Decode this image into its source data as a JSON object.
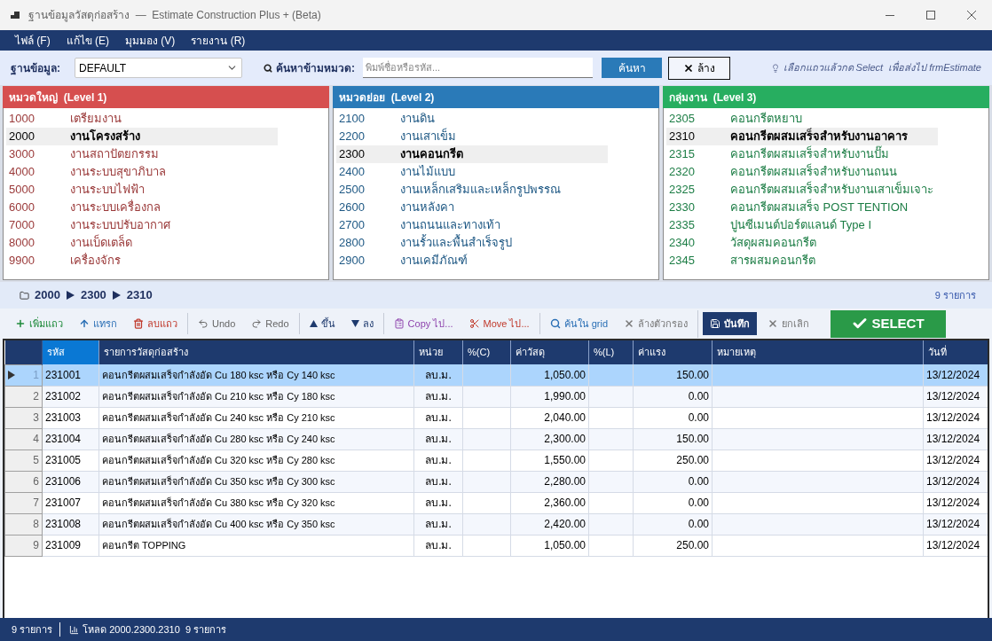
{
  "window": {
    "title": "ฐานข้อมูลวัสดุก่อสร้าง  —  Estimate Construction Plus + (Beta)"
  },
  "menu": [
    {
      "label": "ไฟล์ (F)"
    },
    {
      "label": "แก้ไข (E)"
    },
    {
      "label": "มุมมอง (V)"
    },
    {
      "label": "รายงาน (R)"
    }
  ],
  "search_bar": {
    "database_label": "ฐานข้อมูล:",
    "database": {
      "value": "DEFAULT"
    },
    "search_label": "ค้นหาข้ามหมวด:",
    "search_field": {
      "placeholder": "พิมพ์ชื่อหรือรหัส..."
    },
    "search_button": "ค้นหา",
    "clear_button": "ล้าง",
    "hint": "เลือกแถวแล้วกด Select  เพื่อส่งไป frmEstimate"
  },
  "panels": [
    {
      "title": "หมวดใหญ่  (Level 1)",
      "color": "#d64f4f",
      "items": [
        {
          "code": "1000",
          "name": "เตรียมงาน",
          "selected": false
        },
        {
          "code": "2000",
          "name": "งานโครงสร้าง",
          "selected": true
        },
        {
          "code": "3000",
          "name": "งานสถาปัตยกรรม",
          "selected": false
        },
        {
          "code": "4000",
          "name": "งานระบบสุขาภิบาล",
          "selected": false
        },
        {
          "code": "5000",
          "name": "งานระบบไฟฟ้า",
          "selected": false
        },
        {
          "code": "6000",
          "name": "งานระบบเครื่องกล",
          "selected": false
        },
        {
          "code": "7000",
          "name": "งานระบบปรับอากาศ",
          "selected": false
        },
        {
          "code": "8000",
          "name": "งานเบ็ดเตล็ด",
          "selected": false
        },
        {
          "code": "9900",
          "name": "เครื่องจักร",
          "selected": false
        }
      ]
    },
    {
      "title": "หมวดย่อย  (Level 2)",
      "color": "#2a7ab8",
      "items": [
        {
          "code": "2100",
          "name": "งานดิน",
          "selected": false
        },
        {
          "code": "2200",
          "name": "งานเสาเข็ม",
          "selected": false
        },
        {
          "code": "2300",
          "name": "งานคอนกรีต",
          "selected": true
        },
        {
          "code": "2400",
          "name": "งานไม้แบบ",
          "selected": false
        },
        {
          "code": "2500",
          "name": "งานเหล็กเสริมและเหล็กรูปพรรณ",
          "selected": false
        },
        {
          "code": "2600",
          "name": "งานหลังคา",
          "selected": false
        },
        {
          "code": "2700",
          "name": "งานถนนและทางเท้า",
          "selected": false
        },
        {
          "code": "2800",
          "name": "งานรั้วและพื้นสำเร็จรูป",
          "selected": false
        },
        {
          "code": "2900",
          "name": "งานเคมีภัณฑ์",
          "selected": false
        }
      ]
    },
    {
      "title": "กลุ่มงาน  (Level 3)",
      "color": "#27ae60",
      "items": [
        {
          "code": "2305",
          "name": "คอนกรีตหยาบ",
          "selected": false
        },
        {
          "code": "2310",
          "name": "คอนกรีตผสมเสร็จสำหรับงานอาคาร",
          "selected": true
        },
        {
          "code": "2315",
          "name": "คอนกรีตผสมเสร็จสำหรับงานปั๊ม",
          "selected": false
        },
        {
          "code": "2320",
          "name": "คอนกรีตผสมเสร็จสำหรับงานถนน",
          "selected": false
        },
        {
          "code": "2325",
          "name": "คอนกรีตผสมเสร็จสำหรับงานเสาเข็มเจาะ",
          "selected": false
        },
        {
          "code": "2330",
          "name": "คอนกรีตผสมเสร็จ POST TENTION",
          "selected": false
        },
        {
          "code": "2335",
          "name": "ปูนซีเมนต์ปอร์ตแลนด์ Type I",
          "selected": false
        },
        {
          "code": "2340",
          "name": "วัสดุผสมคอนกรีต",
          "selected": false
        },
        {
          "code": "2345",
          "name": "สารผสมคอนกรีต",
          "selected": false
        }
      ]
    }
  ],
  "breadcrumb": {
    "path": [
      "2000",
      "2300",
      "2310"
    ],
    "count": "9 รายการ"
  },
  "toolbar": {
    "groups": [
      {
        "buttons": [
          {
            "kind": "add",
            "label": "เพิ่มแถว"
          },
          {
            "kind": "insert",
            "label": "แทรก"
          },
          {
            "kind": "delete",
            "label": "ลบแถว"
          }
        ]
      },
      {
        "buttons": [
          {
            "kind": "undo",
            "label": "Undo"
          },
          {
            "kind": "redo",
            "label": "Redo"
          }
        ]
      },
      {
        "buttons": [
          {
            "kind": "up",
            "label": "ขึ้น"
          },
          {
            "kind": "down",
            "label": "ลง"
          }
        ]
      },
      {
        "buttons": [
          {
            "kind": "copy",
            "label": "Copy ไป..."
          },
          {
            "kind": "move",
            "label": "Move ไป..."
          }
        ]
      },
      {
        "buttons": [
          {
            "kind": "find",
            "label": "ค้นใน grid"
          },
          {
            "kind": "clear-filter",
            "label": "ล้างตัวกรอง"
          }
        ]
      },
      {
        "buttons": [
          {
            "kind": "save",
            "label": "บันทึก"
          },
          {
            "kind": "cancel",
            "label": "ยกเลิก"
          },
          {
            "kind": "select",
            "label": "SELECT"
          }
        ]
      }
    ]
  },
  "table": {
    "columns": [
      {
        "label": "รหัส",
        "selected": true
      },
      {
        "label": "รายการวัสดุก่อสร้าง",
        "selected": false
      },
      {
        "label": "หน่วย",
        "selected": false
      },
      {
        "label": "%(C)",
        "selected": false
      },
      {
        "label": "ค่าวัสดุ",
        "selected": false
      },
      {
        "label": "%(L)",
        "selected": false
      },
      {
        "label": "ค่าแรง",
        "selected": false
      },
      {
        "label": "หมายเหตุ",
        "selected": false
      },
      {
        "label": "วันที่",
        "selected": false
      }
    ],
    "rows": [
      {
        "number": "1",
        "selected": true,
        "code": "231001",
        "description": "คอนกรีตผสมเสร็จกำลังอัด Cu 180 ksc หรือ Cy 140 ksc",
        "unit": "ลบ.ม.",
        "material_cost": "1,050.00",
        "labor_cost": "150.00",
        "date": "13/12/2024"
      },
      {
        "number": "2",
        "selected": false,
        "code": "231002",
        "description": "คอนกรีตผสมเสร็จกำลังอัด Cu 210 ksc หรือ Cy 180 ksc",
        "unit": "ลบ.ม.",
        "material_cost": "1,990.00",
        "labor_cost": "0.00",
        "date": "13/12/2024"
      },
      {
        "number": "3",
        "selected": false,
        "code": "231003",
        "description": "คอนกรีตผสมเสร็จกำลังอัด Cu 240 ksc หรือ Cy 210 ksc",
        "unit": "ลบ.ม.",
        "material_cost": "2,040.00",
        "labor_cost": "0.00",
        "date": "13/12/2024"
      },
      {
        "number": "4",
        "selected": false,
        "code": "231004",
        "description": "คอนกรีตผสมเสร็จกำลังอัด Cu 280 ksc หรือ Cy 240 ksc",
        "unit": "ลบ.ม.",
        "material_cost": "2,300.00",
        "labor_cost": "150.00",
        "date": "13/12/2024"
      },
      {
        "number": "5",
        "selected": false,
        "code": "231005",
        "description": "คอนกรีตผสมเสร็จกำลังอัด Cu 320 ksc หรือ Cy 280 ksc",
        "unit": "ลบ.ม.",
        "material_cost": "1,550.00",
        "labor_cost": "250.00",
        "date": "13/12/2024"
      },
      {
        "number": "6",
        "selected": false,
        "code": "231006",
        "description": "คอนกรีตผสมเสร็จกำลังอัด Cu 350 ksc หรือ Cy 300 ksc",
        "unit": "ลบ.ม.",
        "material_cost": "2,280.00",
        "labor_cost": "0.00",
        "date": "13/12/2024"
      },
      {
        "number": "7",
        "selected": false,
        "code": "231007",
        "description": "คอนกรีตผสมเสร็จกำลังอัด Cu 380 ksc หรือ Cy 320 ksc",
        "unit": "ลบ.ม.",
        "material_cost": "2,360.00",
        "labor_cost": "0.00",
        "date": "13/12/2024"
      },
      {
        "number": "8",
        "selected": false,
        "code": "231008",
        "description": "คอนกรีตผสมเสร็จกำลังอัด Cu 400 ksc หรือ Cy 350 ksc",
        "unit": "ลบ.ม.",
        "material_cost": "2,420.00",
        "labor_cost": "0.00",
        "date": "13/12/2024"
      },
      {
        "number": "9",
        "selected": false,
        "code": "231009",
        "description": "คอนกรีต TOPPING",
        "unit": "ลบ.ม.",
        "material_cost": "1,050.00",
        "labor_cost": "250.00",
        "date": "13/12/2024"
      }
    ]
  },
  "status_bar": [
    {
      "kind": "count",
      "text": "9 รายการ"
    },
    {
      "kind": "load",
      "text": "โหลด 2000.2300.2310  9 รายการ"
    }
  ]
}
